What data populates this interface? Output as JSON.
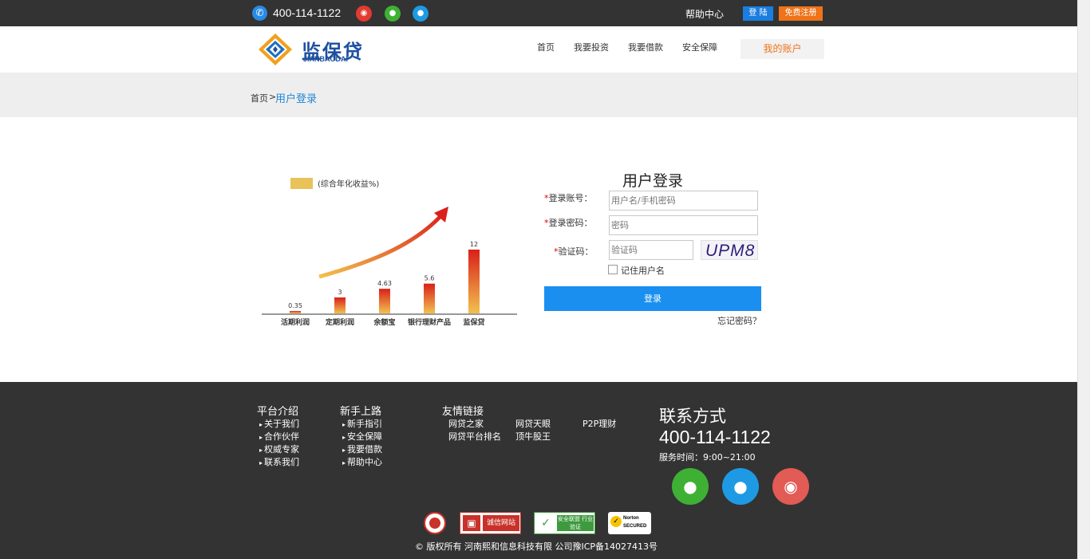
{
  "topbar": {
    "phone": "400-114-1122",
    "help": "帮助中心",
    "login": "登 陆",
    "register": "免费注册",
    "icons": [
      "phone-icon",
      "weibo-icon",
      "wechat-icon",
      "qq-icon"
    ]
  },
  "header": {
    "logo_text": "监保贷",
    "logo_sub": "JIANBAODAI",
    "nav": [
      "首页",
      "我要投资",
      "我要借款",
      "安全保障"
    ],
    "account": "我的账户"
  },
  "breadcrumb": {
    "home": "首页",
    "sep": ">",
    "current": "用户登录"
  },
  "chart_data": {
    "type": "bar",
    "legend": "(综合年化收益%)",
    "categories": [
      "活期利润",
      "定期利润",
      "余额宝",
      "银行理财产品",
      "监保贷"
    ],
    "values": [
      0.35,
      3,
      4.63,
      5.6,
      12
    ],
    "labels": [
      "0.35",
      "3",
      "4.63",
      "5.6",
      "12"
    ],
    "ylim": [
      0,
      12
    ],
    "colors": {
      "legend": "#e9c25a",
      "bar_top": "#d9201a",
      "bar_bottom": "#f2c14e",
      "axis": "#333333"
    }
  },
  "form": {
    "title": "用户登录",
    "account_label": "登录账号：",
    "account_placeholder": "用户名/手机密码",
    "password_label": "登录密码：",
    "password_placeholder": "密码",
    "captcha_label": "验证码：",
    "captcha_placeholder": "验证码",
    "captcha_text": "UPM8",
    "remember": "记住用户名",
    "submit": "登录",
    "forgot": "忘记密码？",
    "required_mark": "*"
  },
  "footer": {
    "col1": {
      "title": "平台介绍",
      "items": [
        "关于我们",
        "合作伙伴",
        "权威专家",
        "联系我们"
      ]
    },
    "col2": {
      "title": "新手上路",
      "items": [
        "新手指引",
        "安全保障",
        "我要借款",
        "帮助中心"
      ]
    },
    "links": {
      "title": "友情链接",
      "items": [
        "网贷之家",
        "网贷天眼",
        "P2P理财",
        "网贷平台排名",
        "顶牛股王"
      ]
    },
    "contact": {
      "title": "联系方式",
      "phone": "400-114-1122",
      "hours": "服务时间：9:00~21:00"
    },
    "badges": [
      "诚信网站",
      "安全联盟 行业验证",
      "Norton SECURED"
    ],
    "copyright": "© 版权所有 河南熙和信息科技有限 公司豫ICP备14027413号"
  },
  "colors": {
    "topbar_bg": "#333333",
    "brand_blue": "#1d4fa0",
    "accent_orange": "#ef7318",
    "link_blue": "#1f86d8",
    "button_blue": "#1a8ff0"
  }
}
